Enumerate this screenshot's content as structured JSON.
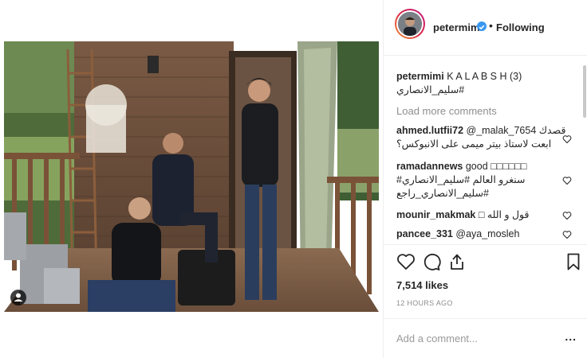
{
  "header": {
    "username": "petermimi",
    "separator": "•",
    "follow_label": "Following",
    "verified_icon": "verified-badge-icon",
    "accent": "#3897f0"
  },
  "caption": {
    "username": "petermimi",
    "text": "K A L A B S H (3)",
    "hashtag": "#سليم_الانصاري"
  },
  "load_more": "Load more comments",
  "comments": [
    {
      "user": "ahmed.lutfii72",
      "line1": "@_malak_7654 قصدك",
      "line2": "ابعت لاستاذ بيتر ميمى على الانبوكس؟"
    },
    {
      "user": "ramadannews",
      "line1": "good □□□□□□",
      "line2": "سنغرو العالم #سليم_الانصاري#",
      "line3": "#سليم_الانصاري_راجع"
    },
    {
      "user": "mounir_makmak",
      "line1": "قول و الله □"
    },
    {
      "user": "pancee_331",
      "line1": "@aya_mosleh"
    }
  ],
  "actions": {
    "like_icon": "heart-icon",
    "comment_icon": "comment-icon",
    "share_icon": "share-icon",
    "save_icon": "bookmark-icon"
  },
  "likes": "7,514 likes",
  "time": "12 HOURS AGO",
  "add_comment": {
    "placeholder": "Add a comment...",
    "more": "..."
  }
}
